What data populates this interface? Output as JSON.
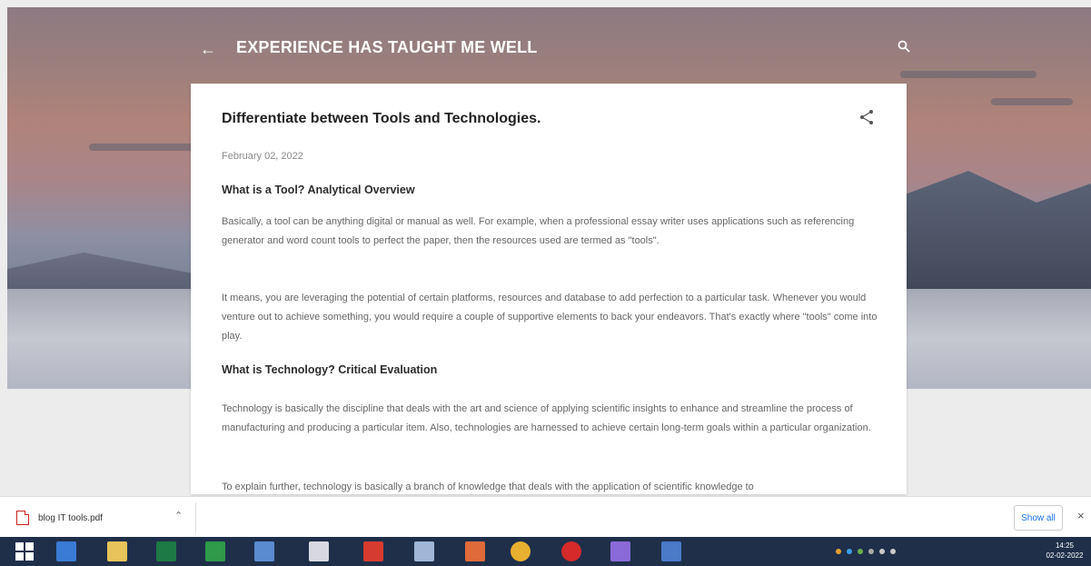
{
  "header": {
    "blog_title": "EXPERIENCE HAS TAUGHT ME WELL",
    "back_icon": "arrow-left-icon",
    "search_icon": "search-icon"
  },
  "post": {
    "title": "Differentiate between Tools and Technologies.",
    "date": "February 02, 2022",
    "share_icon": "share-icon",
    "sections": [
      {
        "heading": "What is a Tool? Analytical Overview"
      },
      {
        "heading": "What is Technology? Critical Evaluation"
      }
    ],
    "paragraphs": [
      "Basically, a tool can be anything digital or manual as well. For example, when a professional essay writer uses applications such as referencing generator and word count tools to perfect the paper, then the resources used are termed as \"tools\".",
      "It means, you are leveraging the potential of certain platforms, resources and database to add perfection to a particular task. Whenever you would venture out to achieve something, you would require a couple of supportive elements to back your endeavors. That's exactly where \"tools\" come into play.",
      "Technology is basically the discipline that deals with the art and science of applying scientific insights to enhance and streamline the process of manufacturing and producing a particular item. Also, technologies are harnessed to achieve certain long-term goals within a particular organization.",
      "To explain further, technology is basically a branch of knowledge that deals with the application of scientific knowledge to"
    ]
  },
  "downloads": {
    "file_name": "blog IT tools.pdf",
    "show_all": "Show all",
    "close": "×"
  },
  "taskbar": {
    "time": "14:25",
    "date": "02-02-2022"
  },
  "colors": {
    "taskbar": "#1f2f4a",
    "link": "#1a73e8",
    "pdf": "#cc2222"
  }
}
